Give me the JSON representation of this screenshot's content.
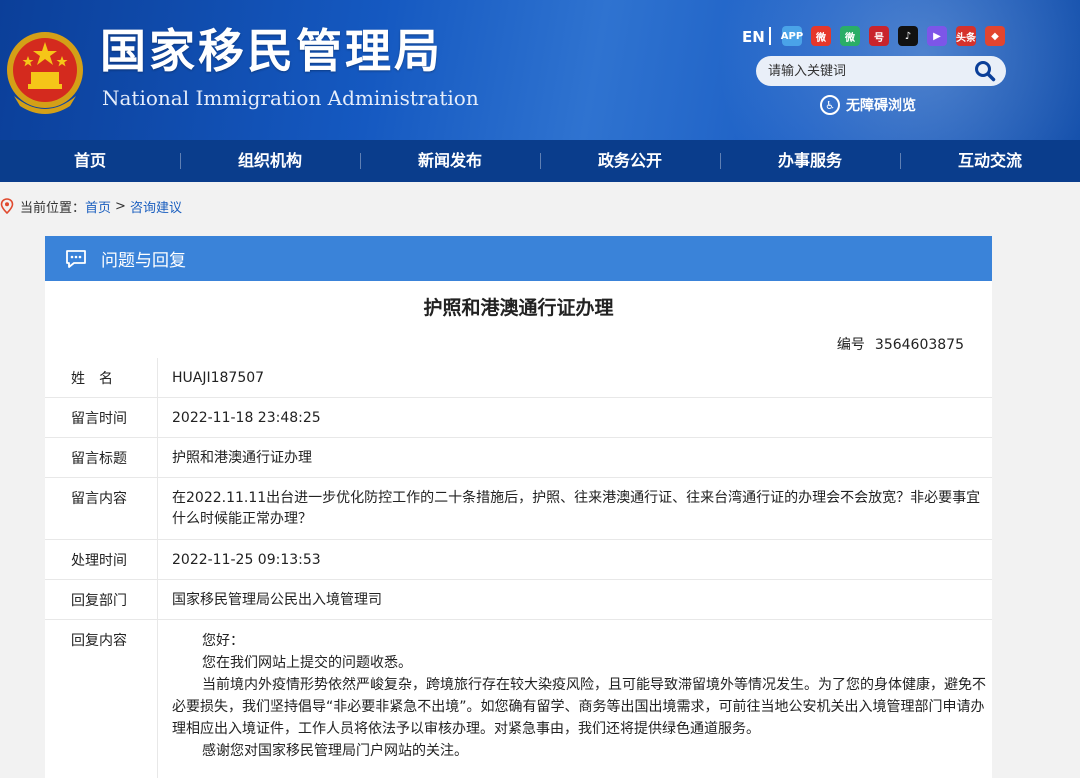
{
  "header": {
    "title": "国家移民管理局",
    "title_en": "National Immigration Administration",
    "lang": "EN",
    "search_placeholder": "请输入关键词",
    "accessibility": "无障碍浏览",
    "social_icons": [
      "app-icon",
      "weibo-icon",
      "wechat-icon",
      "people-icon",
      "douyin-icon",
      "video-icon",
      "toutiao-icon",
      "kuaishou-icon"
    ],
    "social_labels": [
      "APP",
      "微",
      "微",
      "号",
      "♪",
      "▶",
      "头条",
      "◆"
    ],
    "social_colors": [
      "#4aa3e8",
      "#e6372a",
      "#2aae67",
      "#c9242c",
      "#111111",
      "#7d56e8",
      "#d6322c",
      "#e2452f"
    ]
  },
  "nav": [
    "首页",
    "组织机构",
    "新闻发布",
    "政务公开",
    "办事服务",
    "互动交流"
  ],
  "breadcrumb": {
    "label": "当前位置：",
    "home": "首页",
    "separator": ">",
    "current": "咨询建议"
  },
  "panel": {
    "heading": "问题与回复",
    "title": "护照和港澳通行证办理",
    "number_label": "编号",
    "number": "3564603875",
    "rows": [
      {
        "label": "姓名",
        "value": "HUAJI187507"
      },
      {
        "label": "留言时间",
        "value": "2022-11-18 23:48:25"
      },
      {
        "label": "留言标题",
        "value": "护照和港澳通行证办理"
      },
      {
        "label": "留言内容",
        "value": "在2022.11.11出台进一步优化防控工作的二十条措施后，护照、往来港澳通行证、往来台湾通行证的办理会不会放宽？非必要事宜什么时候能正常办理？"
      },
      {
        "label": "处理时间",
        "value": "2022-11-25 09:13:53"
      },
      {
        "label": "回复部门",
        "value": "国家移民管理局公民出入境管理司"
      },
      {
        "label": "回复内容",
        "paragraphs": [
          "您好：",
          "您在我们网站上提交的问题收悉。",
          "当前境内外疫情形势依然严峻复杂，跨境旅行存在较大染疫风险，且可能导致滞留境外等情况发生。为了您的身体健康，避免不必要损失，我们坚持倡导“非必要非紧急不出境”。如您确有留学、商务等出国出境需求，可前往当地公安机关出入境管理部门申请办理相应出入境证件，工作人员将依法予以审核办理。对紧急事由，我们还将提供绿色通道服务。",
          "感谢您对国家移民管理局门户网站的关注。"
        ]
      }
    ]
  }
}
